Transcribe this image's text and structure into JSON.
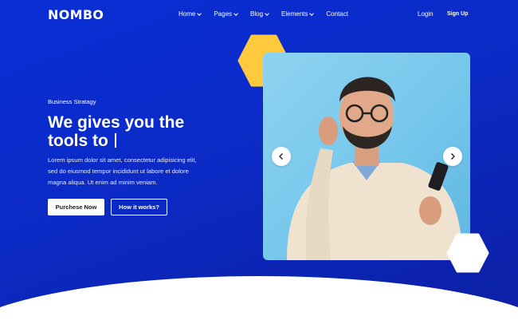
{
  "brand": {
    "logo_text": "NOMBO"
  },
  "nav": {
    "items": [
      {
        "label": "Home",
        "has_dropdown": true
      },
      {
        "label": "Pages",
        "has_dropdown": true
      },
      {
        "label": "Blog",
        "has_dropdown": true
      },
      {
        "label": "Elements",
        "has_dropdown": true
      },
      {
        "label": "Contact",
        "has_dropdown": false
      }
    ],
    "login_label": "Login",
    "signup_label": "Sign Up"
  },
  "hero": {
    "eyebrow": "Business Stratagy",
    "headline_line1": "We gives you the",
    "headline_line2": "tools to",
    "description": "Lorem ipsum dolor sit amet, consectetur adipisicing elit, sed do eiusmod tempor incididunt ut labore et dolore magna aliqua. Ut enim ad minim veniam.",
    "primary_button": "Purchese Now",
    "secondary_button": "How it works?"
  },
  "slider": {
    "prev_icon": "chevron-left-icon",
    "next_icon": "chevron-right-icon"
  },
  "colors": {
    "hero_blue": "#0a2fd6",
    "accent_yellow": "#ffc93c",
    "white": "#ffffff"
  }
}
